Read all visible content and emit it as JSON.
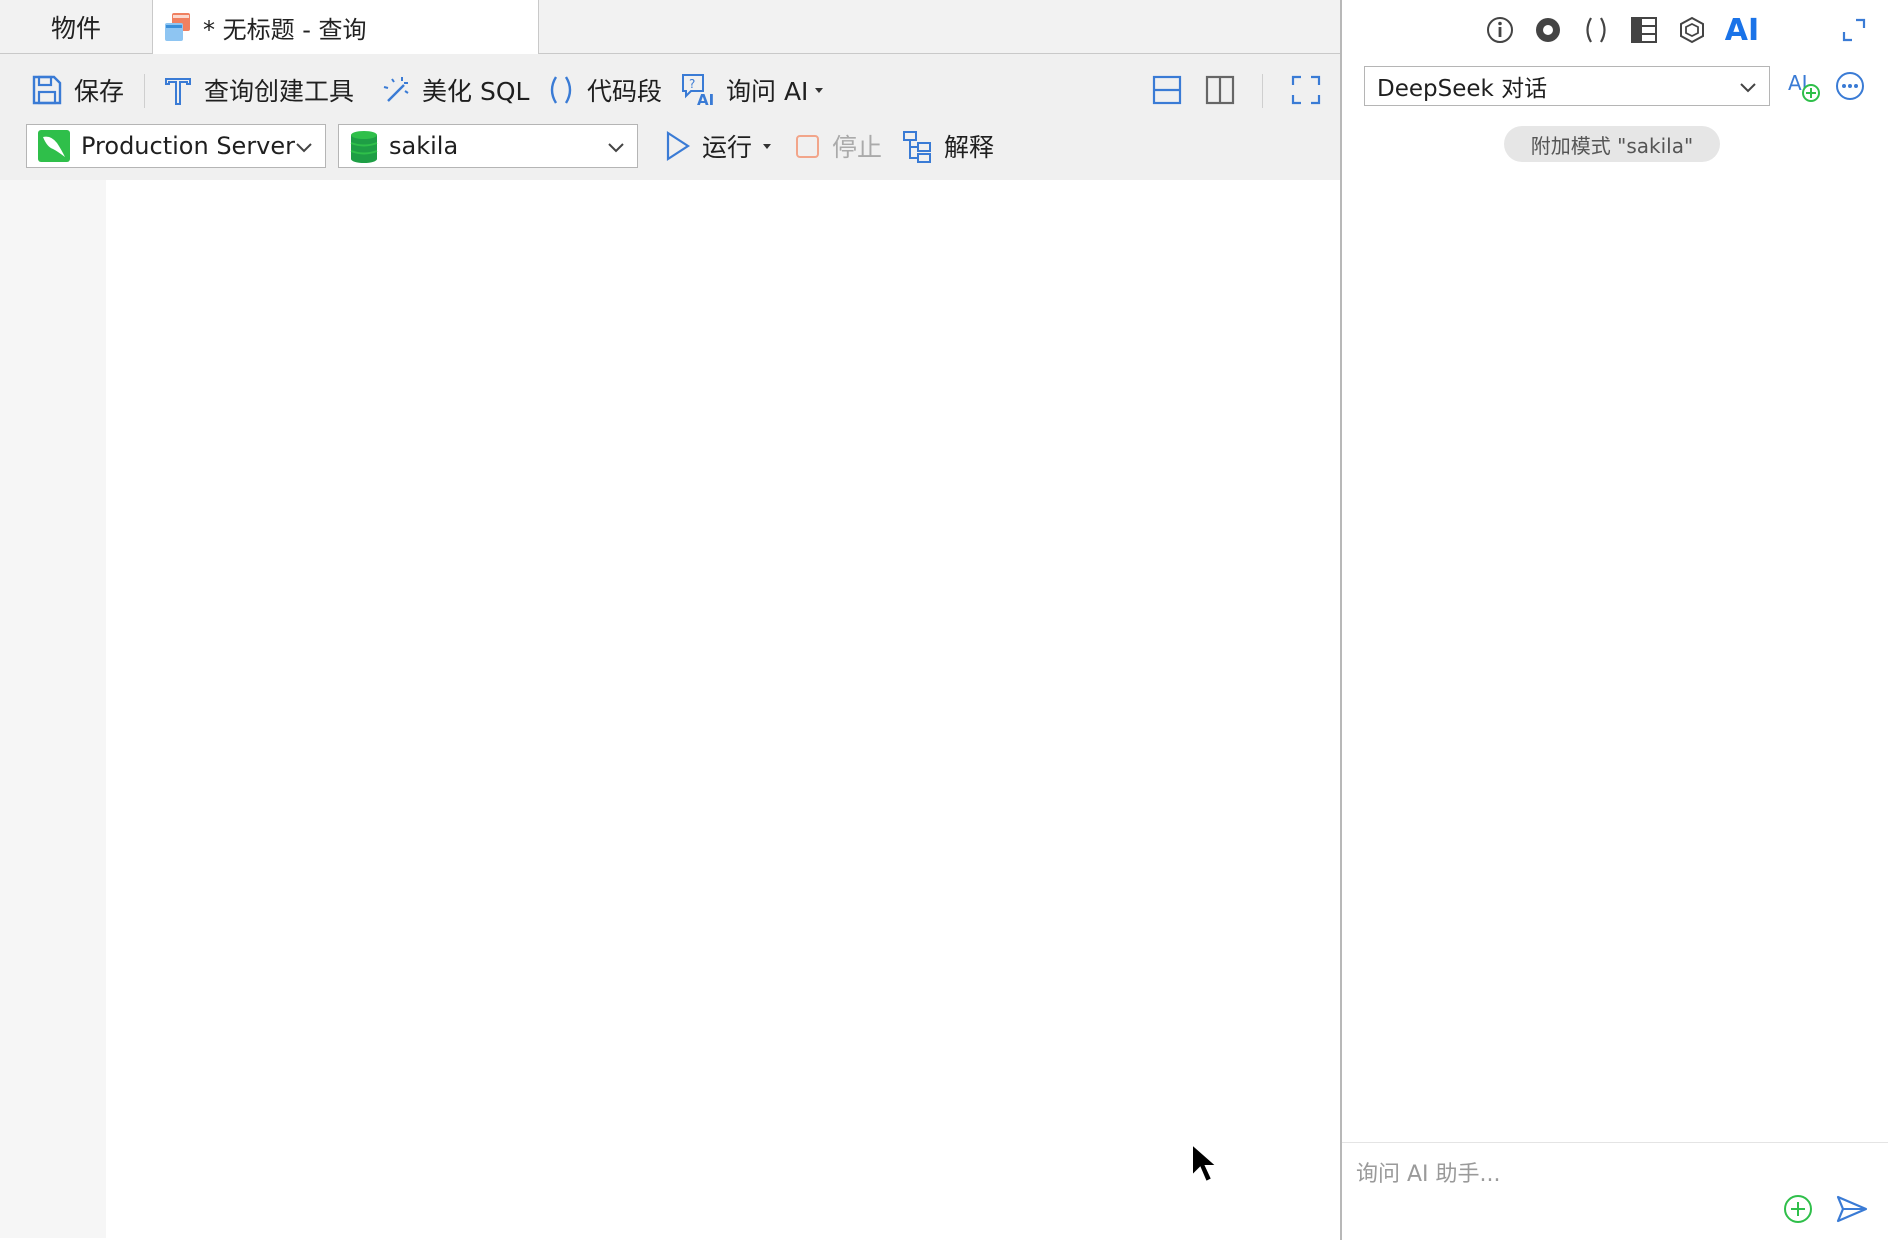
{
  "tabs": {
    "objects_label": "物件",
    "query_label": "* 无标题 - 查询"
  },
  "toolbar": {
    "save": "保存",
    "query_builder": "查询创建工具",
    "beautify_sql": "美化 SQL",
    "code_snippet": "代码段",
    "ask_ai": "询问 AI",
    "run": "运行",
    "stop": "停止",
    "explain": "解释"
  },
  "connection": {
    "server": "Production Server",
    "database": "sakila"
  },
  "ai_panel": {
    "ai_icon_label": "AI",
    "model": "DeepSeek 对话",
    "attach_mode": "附加模式 \"sakila\"",
    "input_placeholder": "询问 AI 助手..."
  },
  "colors": {
    "accent": "#1a73e8",
    "green": "#2fbf4a",
    "stop_orange": "#f2a58a",
    "toolbar_bg": "#f0f0f0"
  }
}
